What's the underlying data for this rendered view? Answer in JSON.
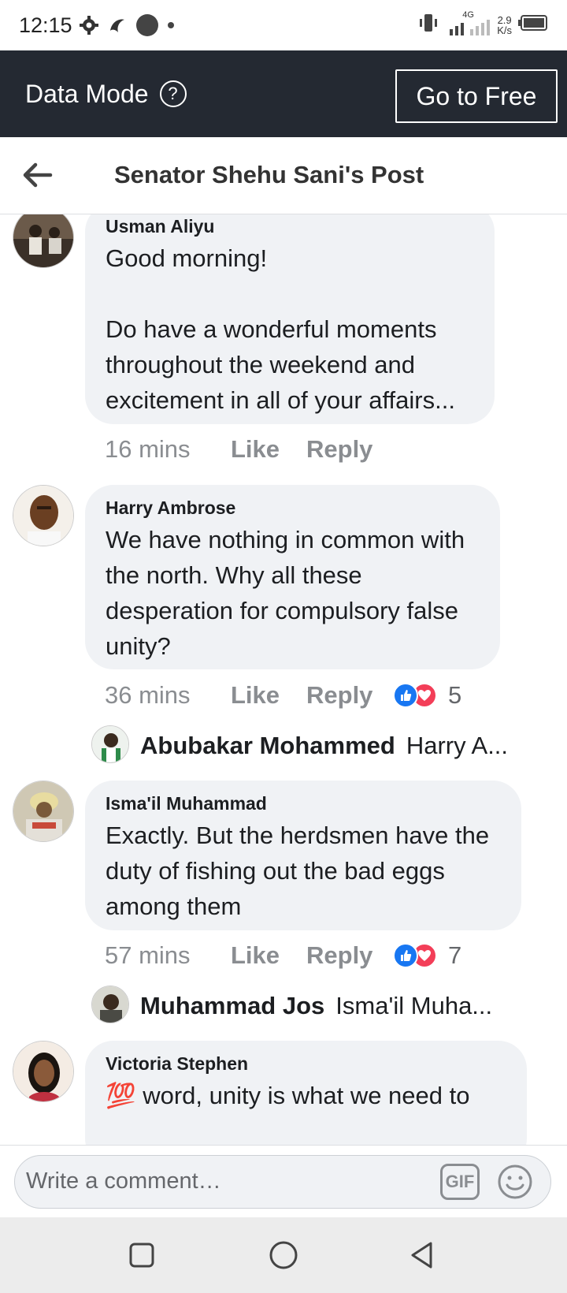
{
  "status_bar": {
    "time": "12:15",
    "network": "4G",
    "speed_value": "2.9",
    "speed_unit": "K/s"
  },
  "banner": {
    "title": "Data Mode",
    "help": "?",
    "go_free_label": "Go to Free"
  },
  "header": {
    "title": "Senator Shehu Sani's Post"
  },
  "comments": [
    {
      "name": "Usman Aliyu",
      "text": "Good morning!\n\nDo have a wonderful moments throughout the weekend and excitement in all of your affairs...",
      "time": "16 mins",
      "like": "Like",
      "reply": "Reply"
    },
    {
      "name": "Harry Ambrose",
      "text": "We have nothing in common with the north. Why all these desperation for compulsory false unity?",
      "time": "36 mins",
      "like": "Like",
      "reply": "Reply",
      "reactions": "5",
      "reply_preview": {
        "name": "Abubakar Mohammed",
        "text": "Harry A..."
      }
    },
    {
      "name": "Isma'il Muhammad",
      "text": "Exactly. But the herdsmen have the duty of fishing out the bad eggs among them",
      "time": "57 mins",
      "like": "Like",
      "reply": "Reply",
      "reactions": "7",
      "reply_preview": {
        "name": "Muhammad Jos",
        "text": "Isma'il Muha..."
      }
    },
    {
      "name": "Victoria Stephen",
      "text": "💯 word, unity is what we need to"
    }
  ],
  "composer": {
    "placeholder": "Write a comment…",
    "gif_label": "GIF"
  },
  "icons": {
    "back": "arrow-left-icon",
    "emoji": "smiley-icon",
    "nav": [
      "square-icon",
      "circle-icon",
      "triangle-back-icon"
    ]
  },
  "colors": {
    "banner_bg": "#242932",
    "bubble_bg": "#f0f2f5",
    "like_blue": "#1877f2",
    "love_red": "#f33e58",
    "meta_gray": "#8a8d91"
  }
}
